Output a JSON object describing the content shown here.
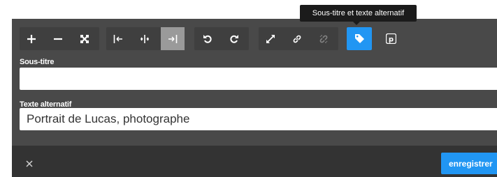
{
  "tooltip": {
    "text": "Sous-titre et texte alternatif"
  },
  "toolbar": {
    "groups": [
      {
        "name": "zoom",
        "buttons": [
          "zoom-in-icon",
          "zoom-out-icon",
          "fit-screen-icon"
        ]
      },
      {
        "name": "alignment",
        "buttons": [
          "align-left-icon",
          "align-center-icon",
          "align-right-icon"
        ],
        "active": "align-right-icon"
      },
      {
        "name": "rotate",
        "buttons": [
          "rotate-left-icon",
          "rotate-right-icon"
        ]
      },
      {
        "name": "link",
        "buttons": [
          "resize-icon",
          "link-icon",
          "unlink-icon"
        ],
        "disabled": "unlink-icon"
      },
      {
        "name": "meta",
        "buttons": [
          "tag-icon",
          "pinterest-icon"
        ],
        "active": "tag-icon"
      }
    ]
  },
  "caption": {
    "label": "Sous-titre",
    "value": ""
  },
  "alt_text": {
    "label": "Texte alternatif",
    "value": "Portrait de Lucas, photographe"
  },
  "footer": {
    "close_icon": "close-icon",
    "save_label": "enregistrer"
  },
  "colors": {
    "panel": "#494949",
    "footer": "#333333",
    "accent": "#2196f3",
    "tooltip": "#1b1b1b"
  }
}
